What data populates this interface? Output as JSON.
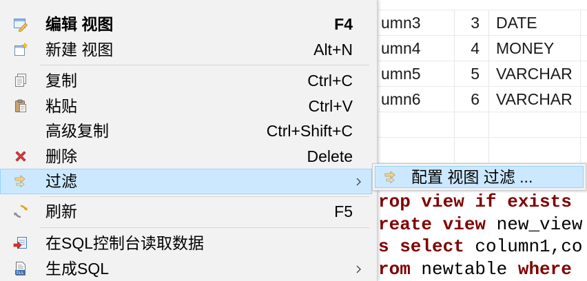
{
  "context_menu": {
    "items": [
      {
        "label": "编辑 视图",
        "shortcut": "F4",
        "icon": "edit-view-icon",
        "bold": true
      },
      {
        "label": "新建 视图",
        "shortcut": "Alt+N",
        "icon": "new-view-icon"
      },
      {
        "label": "复制",
        "shortcut": "Ctrl+C",
        "icon": "copy-icon"
      },
      {
        "label": "粘贴",
        "shortcut": "Ctrl+V",
        "icon": "paste-icon"
      },
      {
        "label": "高级复制",
        "shortcut": "Ctrl+Shift+C"
      },
      {
        "label": "删除",
        "shortcut": "Delete",
        "icon": "delete-icon"
      },
      {
        "label": "过滤",
        "icon": "filter-icon",
        "has_submenu": true,
        "highlighted": true
      },
      {
        "label": "刷新",
        "shortcut": "F5",
        "icon": "refresh-icon"
      },
      {
        "label": "在SQL控制台读取数据",
        "icon": "read-data-icon"
      },
      {
        "label": "生成SQL",
        "icon": "generate-sql-icon",
        "has_submenu": true
      }
    ]
  },
  "filter_submenu": {
    "items": [
      {
        "label": "配置 视图 过滤 ...",
        "icon": "filter-icon",
        "highlighted": true
      }
    ]
  },
  "result_grid": {
    "rows": [
      {
        "column_name": "umn3",
        "ordinal": "3",
        "data_type": "DATE"
      },
      {
        "column_name": "umn4",
        "ordinal": "4",
        "data_type": "MONEY"
      },
      {
        "column_name": "umn5",
        "ordinal": "5",
        "data_type": "VARCHAR"
      },
      {
        "column_name": "umn6",
        "ordinal": "6",
        "data_type": "VARCHAR"
      }
    ]
  },
  "sql_editor": {
    "lines": [
      [
        {
          "text": "rop view if exists",
          "keyword": true
        }
      ],
      [
        {
          "text": "reate view",
          "keyword": true
        },
        {
          "text": " new_view",
          "keyword": false
        }
      ],
      [
        {
          "text": "s select",
          "keyword": true
        },
        {
          "text": " column1,co",
          "keyword": false
        }
      ],
      [
        {
          "text": "rom",
          "keyword": true
        },
        {
          "text": " newtable ",
          "keyword": false
        },
        {
          "text": "where",
          "keyword": true
        }
      ]
    ]
  },
  "colors": {
    "menu_background": "#f2f2f2",
    "hover_highlight": "#cce8ff",
    "hover_border": "#99d1ff",
    "sql_keyword": "#800000",
    "delete_icon": "#e0393e"
  }
}
